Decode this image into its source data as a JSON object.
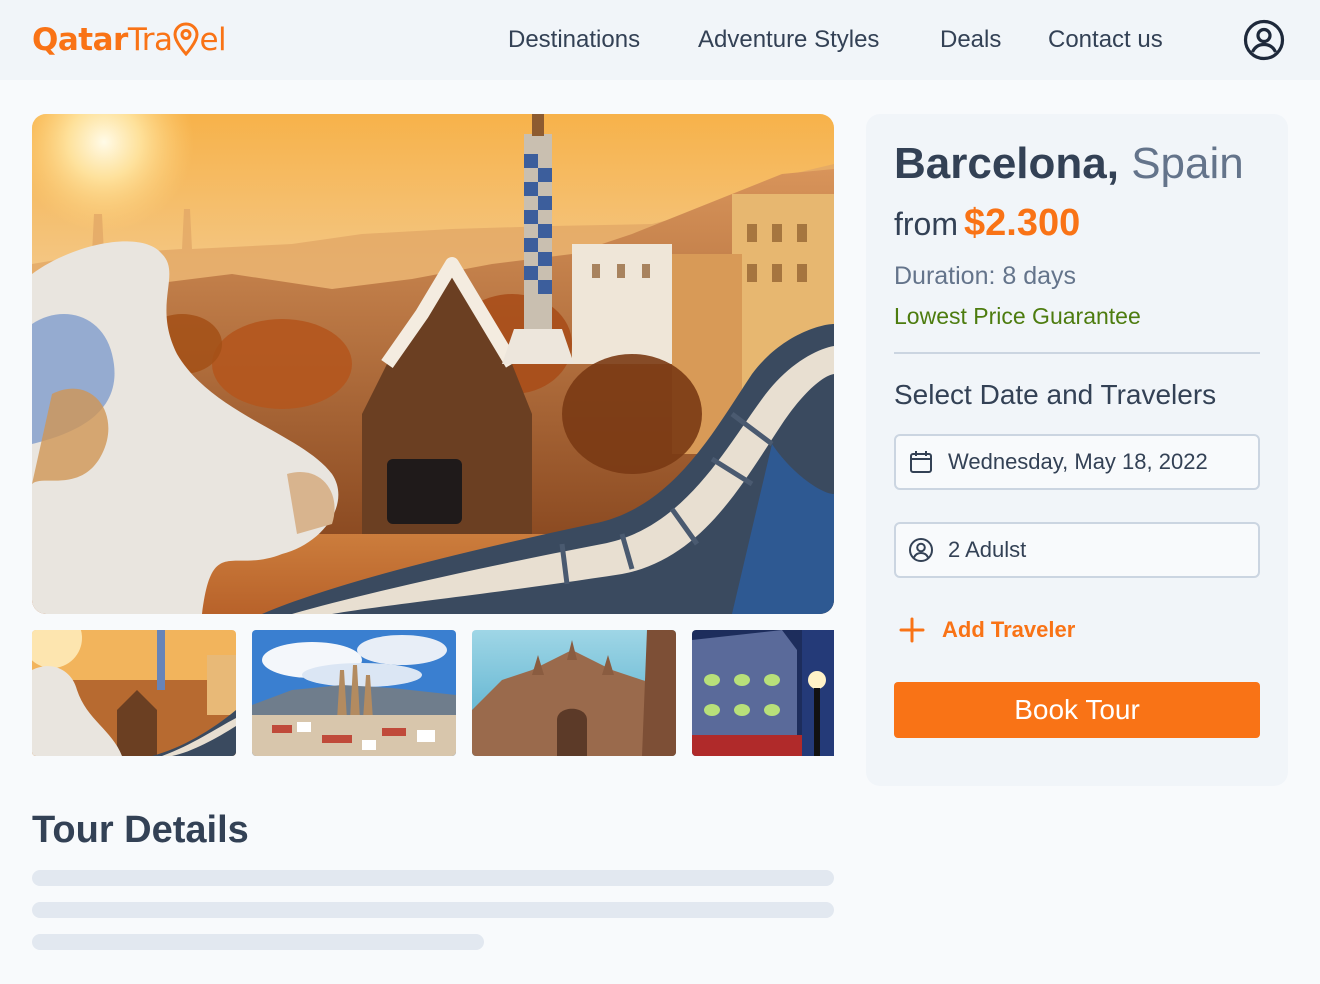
{
  "brand": {
    "name_bold": "Qatar",
    "name_light_a": "Tra",
    "name_light_b": "el"
  },
  "nav": {
    "items": [
      "Destinations",
      "Adventure Styles",
      "Deals",
      "Contact us"
    ],
    "account_icon": "user-circle-icon"
  },
  "gallery": {
    "hero_alt": "Park Güell at sunset",
    "thumbnails": [
      "Park Güell",
      "Sagrada Família skyline",
      "Barcelona Cathedral",
      "Casa Batlló"
    ],
    "thumb_alts": [
      "park-guell",
      "sagrada-familia",
      "cathedral",
      "casa-batllo"
    ]
  },
  "tour": {
    "title": "Tour Details"
  },
  "booking": {
    "city": "Barcelona,",
    "country": " Spain",
    "from_label": "from",
    "price": "$2.300",
    "duration": "Duration: 8 days",
    "guarantee": "Lowest Price Guarantee",
    "select_title": "Select Date and Travelers",
    "date_value": "Wednesday, May 18, 2022",
    "date_icon": "calendar-icon",
    "travelers_value": "2 Adulst",
    "travelers_icon": "user-circle-icon",
    "add_traveler_label": "Add Traveler",
    "book_label": "Book Tour"
  },
  "colors": {
    "accent": "#f97316",
    "text": "#334155",
    "muted": "#64748b",
    "success": "#4d7c0f",
    "page_bg": "#f8fafc",
    "panel_bg": "#f1f5f9"
  }
}
